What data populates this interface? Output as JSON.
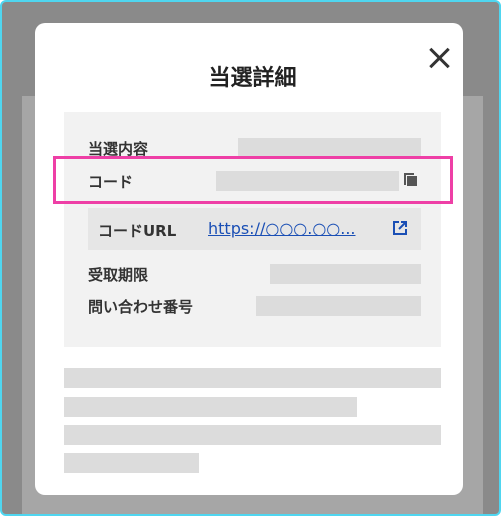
{
  "modal": {
    "title": "当選詳細",
    "close_icon": "close-icon"
  },
  "details": {
    "prize_label": "当選内容",
    "code_label": "コード",
    "code_url_label": "コードURL",
    "code_url_value": "https://○○○.○○...",
    "deadline_label": "受取期限",
    "inquiry_label": "問い合わせ番号"
  },
  "icons": {
    "copy": "copy-icon",
    "external_link": "external-link-icon"
  },
  "colors": {
    "highlight": "#ee3fa6",
    "link": "#1a4fb5",
    "frame": "#4fd6f0"
  }
}
